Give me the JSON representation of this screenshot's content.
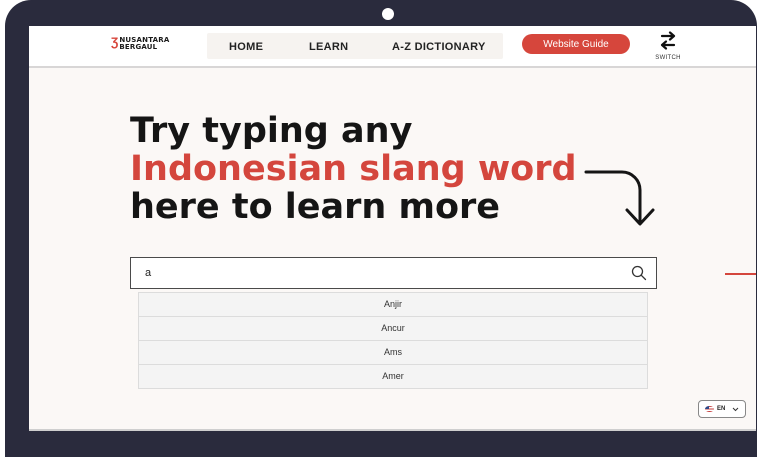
{
  "app": {
    "logo": {
      "line1": "NUSANTARA",
      "line2": "BERGAUL",
      "mark": "Ʒ"
    },
    "nav": {
      "items": [
        "HOME",
        "LEARN",
        "A-Z DICTIONARY"
      ]
    },
    "guide_button": "Website Guide",
    "switch_label": "SWITCH"
  },
  "hero": {
    "line1": "Try typing any",
    "line2": "Indonesian slang word",
    "line3": "here to learn more"
  },
  "search": {
    "value": "a"
  },
  "suggestions": [
    "Anjir",
    "Ancur",
    "Ams",
    "Amer"
  ],
  "language": {
    "code": "EN",
    "icon": "us-flag-icon"
  },
  "colors": {
    "accent": "#d6463c",
    "bezel": "#2a2b3d",
    "background": "#fbf8f6"
  },
  "icons": [
    "switch-icon",
    "search-icon",
    "curved-arrow-down-icon",
    "chevron-down-icon"
  ]
}
